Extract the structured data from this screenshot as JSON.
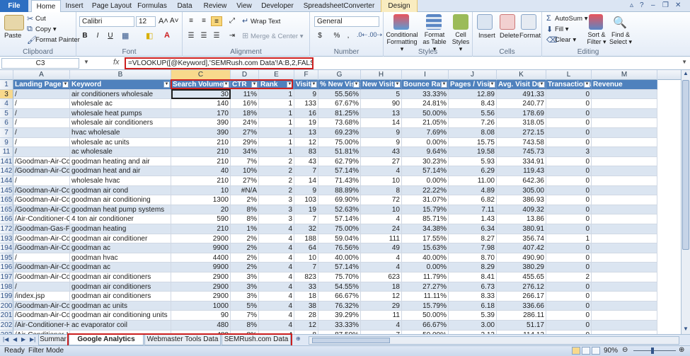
{
  "ribbon_tabs": [
    "File",
    "Home",
    "Insert",
    "Page Layout",
    "Formulas",
    "Data",
    "Review",
    "View",
    "Developer",
    "SpreadsheetConverter v7",
    "Design"
  ],
  "active_tab": "Home",
  "clipboard": {
    "paste": "Paste",
    "cut": "Cut",
    "copy": "Copy ▾",
    "format_painter": "Format Painter",
    "label": "Clipboard"
  },
  "font": {
    "name": "Calibri",
    "size": "12",
    "bold": "B",
    "italic": "I",
    "underline": "U",
    "label": "Font"
  },
  "alignment": {
    "wrap": "Wrap Text",
    "merge": "Merge & Center ▾",
    "label": "Alignment"
  },
  "number": {
    "format": "General",
    "currency": "$",
    "percent": "%",
    "comma": ",",
    "label": "Number"
  },
  "styles": {
    "cond": "Conditional Formatting ▾",
    "table": "Format as Table ▾",
    "cell": "Cell Styles ▾",
    "label": "Styles"
  },
  "cells": {
    "insert": "Insert",
    "delete": "Delete",
    "format": "Format",
    "label": "Cells"
  },
  "editing": {
    "autosum": "AutoSum ▾",
    "fill": "Fill ▾",
    "clear": "Clear ▾",
    "sort": "Sort & Filter ▾",
    "find": "Find & Select ▾",
    "label": "Editing"
  },
  "formula_bar": {
    "name_box": "C3",
    "fx": "fx",
    "formula": "=VLOOKUP([@Keyword],'SEMRush.com Data'!A:B,2,FALSE)"
  },
  "columns": [
    "A",
    "B",
    "C",
    "D",
    "E",
    "F",
    "G",
    "H",
    "I",
    "J",
    "K",
    "L",
    "M"
  ],
  "headers": [
    "Landing Page",
    "Keyword",
    "Search Volume",
    "CTR",
    "Rank",
    "Visits",
    "% New Visits",
    "New Visits",
    "Bounce Rate",
    "Pages / Visit",
    "Avg. Visit Dur",
    "Transactions",
    "Revenue"
  ],
  "rows": [
    {
      "n": "1",
      "cells": []
    },
    {
      "n": "3",
      "cells": [
        "/",
        "air conditioners wholesale",
        "30",
        "11%",
        "1",
        "9",
        "55.56%",
        "5",
        "33.33%",
        "12.89",
        "491.33",
        "0",
        ""
      ]
    },
    {
      "n": "4",
      "cells": [
        "/",
        "wholesale ac",
        "140",
        "16%",
        "1",
        "133",
        "67.67%",
        "90",
        "24.81%",
        "8.43",
        "240.77",
        "0",
        ""
      ]
    },
    {
      "n": "5",
      "cells": [
        "/",
        "wholesale heat pumps",
        "170",
        "18%",
        "1",
        "16",
        "81.25%",
        "13",
        "50.00%",
        "5.56",
        "178.69",
        "0",
        ""
      ]
    },
    {
      "n": "6",
      "cells": [
        "/",
        "wholesale air conditioners",
        "390",
        "24%",
        "1",
        "19",
        "73.68%",
        "14",
        "21.05%",
        "7.26",
        "318.05",
        "0",
        ""
      ]
    },
    {
      "n": "7",
      "cells": [
        "/",
        "hvac wholesale",
        "390",
        "27%",
        "1",
        "13",
        "69.23%",
        "9",
        "7.69%",
        "8.08",
        "272.15",
        "0",
        ""
      ]
    },
    {
      "n": "9",
      "cells": [
        "/",
        "wholesale ac units",
        "210",
        "29%",
        "1",
        "12",
        "75.00%",
        "9",
        "0.00%",
        "15.75",
        "743.58",
        "0",
        ""
      ]
    },
    {
      "n": "11",
      "cells": [
        "/",
        "ac wholesale",
        "210",
        "34%",
        "1",
        "83",
        "51.81%",
        "43",
        "9.64%",
        "19.58",
        "745.73",
        "3",
        ""
      ]
    },
    {
      "n": "141",
      "cells": [
        "/Goodman-Air-Conc",
        "goodman heating and air",
        "210",
        "7%",
        "2",
        "43",
        "62.79%",
        "27",
        "30.23%",
        "5.93",
        "334.91",
        "0",
        ""
      ]
    },
    {
      "n": "142",
      "cells": [
        "/Goodman-Air-Conc",
        "goodman heat and air",
        "40",
        "10%",
        "2",
        "7",
        "57.14%",
        "4",
        "57.14%",
        "6.29",
        "119.43",
        "0",
        ""
      ]
    },
    {
      "n": "144",
      "cells": [
        "/",
        "wholesale hvac",
        "210",
        "27%",
        "2",
        "14",
        "71.43%",
        "10",
        "0.00%",
        "11.00",
        "642.36",
        "0",
        ""
      ]
    },
    {
      "n": "145",
      "cells": [
        "/Goodman-Air-Conc",
        "goodman air cond",
        "10",
        "#N/A",
        "2",
        "9",
        "88.89%",
        "8",
        "22.22%",
        "4.89",
        "305.00",
        "0",
        ""
      ]
    },
    {
      "n": "165",
      "cells": [
        "/Goodman-Air-Conc",
        "goodman air conditioning",
        "1300",
        "2%",
        "3",
        "103",
        "69.90%",
        "72",
        "31.07%",
        "6.82",
        "386.93",
        "0",
        ""
      ]
    },
    {
      "n": "165",
      "cells": [
        "/Goodman-Air-Conc",
        "goodman heat pump systems",
        "20",
        "8%",
        "3",
        "19",
        "52.63%",
        "10",
        "15.79%",
        "7.11",
        "409.32",
        "0",
        ""
      ]
    },
    {
      "n": "166",
      "cells": [
        "/Air-Conditioner-Co",
        "4 ton air conditioner",
        "590",
        "8%",
        "3",
        "7",
        "57.14%",
        "4",
        "85.71%",
        "1.43",
        "13.86",
        "0",
        ""
      ]
    },
    {
      "n": "172",
      "cells": [
        "/Goodman-Gas-Fur",
        "goodman heating",
        "210",
        "1%",
        "4",
        "32",
        "75.00%",
        "24",
        "34.38%",
        "6.34",
        "380.91",
        "0",
        ""
      ]
    },
    {
      "n": "193",
      "cells": [
        "/Goodman-Air-Conc",
        "goodman air conditioner",
        "2900",
        "2%",
        "4",
        "188",
        "59.04%",
        "111",
        "17.55%",
        "8.27",
        "356.74",
        "1",
        ""
      ]
    },
    {
      "n": "194",
      "cells": [
        "/Goodman-Air-Conc",
        "goodman ac",
        "9900",
        "2%",
        "4",
        "64",
        "76.56%",
        "49",
        "15.63%",
        "7.98",
        "407.42",
        "0",
        ""
      ]
    },
    {
      "n": "195",
      "cells": [
        "/",
        "goodman hvac",
        "4400",
        "2%",
        "4",
        "10",
        "40.00%",
        "4",
        "40.00%",
        "8.70",
        "490.90",
        "0",
        ""
      ]
    },
    {
      "n": "196",
      "cells": [
        "/Goodman-Air-Conc",
        "goodman ac",
        "9900",
        "2%",
        "4",
        "7",
        "57.14%",
        "4",
        "0.00%",
        "8.29",
        "380.29",
        "0",
        ""
      ]
    },
    {
      "n": "197",
      "cells": [
        "/Goodman-Air-Conc",
        "goodman air conditioners",
        "2900",
        "3%",
        "4",
        "823",
        "75.70%",
        "623",
        "11.79%",
        "8.41",
        "455.65",
        "2",
        ""
      ]
    },
    {
      "n": "198",
      "cells": [
        "/",
        "goodman air conditioners",
        "2900",
        "3%",
        "4",
        "33",
        "54.55%",
        "18",
        "27.27%",
        "6.73",
        "276.12",
        "0",
        ""
      ]
    },
    {
      "n": "199",
      "cells": [
        "/index.jsp",
        "goodman air conditioners",
        "2900",
        "3%",
        "4",
        "18",
        "66.67%",
        "12",
        "11.11%",
        "8.33",
        "266.17",
        "0",
        ""
      ]
    },
    {
      "n": "200",
      "cells": [
        "/Goodman-Air-Conc",
        "goodman ac units",
        "1000",
        "5%",
        "4",
        "38",
        "76.32%",
        "29",
        "15.79%",
        "6.18",
        "336.66",
        "0",
        ""
      ]
    },
    {
      "n": "201",
      "cells": [
        "/Goodman-Air-Conc",
        "goodman air conditioning units",
        "90",
        "7%",
        "4",
        "28",
        "39.29%",
        "11",
        "50.00%",
        "5.39",
        "286.11",
        "0",
        ""
      ]
    },
    {
      "n": "202",
      "cells": [
        "/Air-Conditioner-He",
        "ac evaporator coil",
        "480",
        "8%",
        "4",
        "12",
        "33.33%",
        "4",
        "66.67%",
        "3.00",
        "51.17",
        "0",
        ""
      ]
    },
    {
      "n": "203",
      "cells": [
        "/Air-Conditioner-He",
        "",
        "480",
        "8%",
        "4",
        "8",
        "87.50%",
        "7",
        "50.00%",
        "2.13",
        "114.13",
        "0",
        ""
      ]
    }
  ],
  "sheet_tabs": [
    "Summar",
    "Google Analytics Data",
    "Webmaster Tools Data",
    "SEMRush.com Data"
  ],
  "active_sheet": "Google Analytics Data",
  "status": {
    "ready": "Ready",
    "mode": "Filter Mode",
    "zoom": "90%"
  },
  "colors": {
    "header_fill": "#4f81bd",
    "band": "#dbe5f1",
    "highlight": "#cc1f1f",
    "file_tab": "#2d6fc2"
  }
}
